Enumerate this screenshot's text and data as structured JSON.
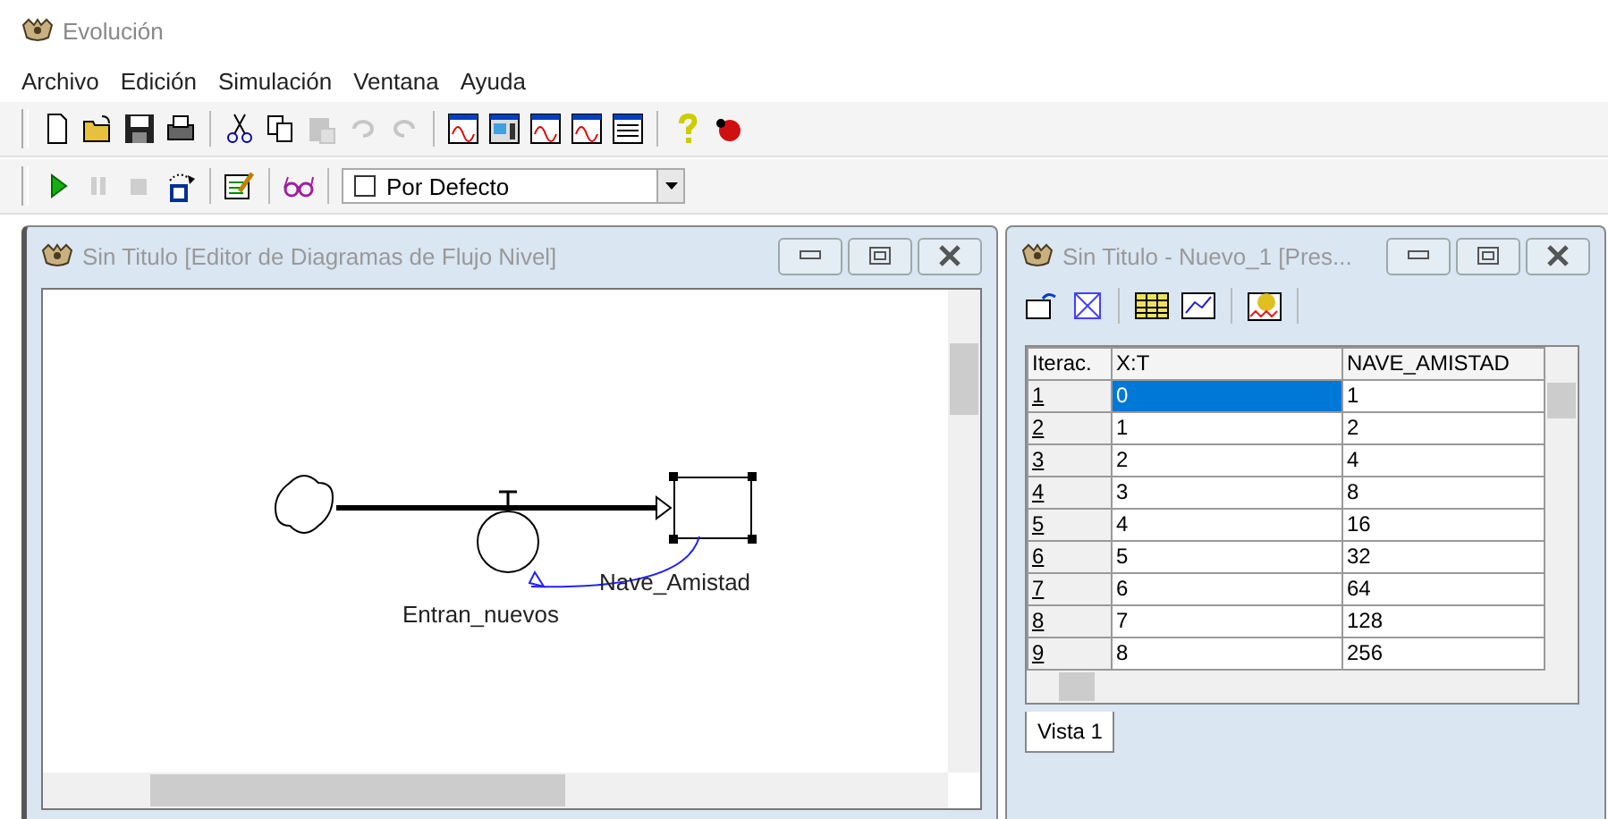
{
  "window": {
    "title": "Evolución"
  },
  "menu": [
    "Archivo",
    "Edición",
    "Simulación",
    "Ventana",
    "Ayuda"
  ],
  "toolbar1": [
    {
      "disabled": false
    },
    {
      "disabled": false
    },
    {
      "disabled": false
    },
    {
      "disabled": false
    },
    {
      "disabled": false
    },
    {
      "disabled": false
    },
    {
      "disabled": true
    },
    {
      "disabled": true
    },
    {
      "disabled": true
    },
    {
      "disabled": false
    },
    {
      "disabled": false
    },
    {
      "disabled": false
    },
    {
      "disabled": false
    },
    {
      "disabled": false
    },
    {
      "disabled": false
    },
    {
      "disabled": false
    }
  ],
  "toolbar2": [
    {
      "disabled": false
    },
    {
      "disabled": true
    },
    {
      "disabled": true
    },
    {
      "disabled": false
    },
    {
      "disabled": false
    },
    {
      "disabled": false
    }
  ],
  "scenario_dropdown": {
    "value": "Por Defecto",
    "checked": false
  },
  "editor_window": {
    "title": "Sin Titulo [Editor de Diagramas de Flujo Nivel]",
    "flow": {
      "name": "Entran_nuevos"
    },
    "stock": {
      "name": "Nave_Amistad",
      "selected": true
    }
  },
  "table_window": {
    "title": "Sin Titulo - Nuevo_1 [Pres...",
    "table": {
      "columns": [
        "Iterac.",
        "X:T",
        "NAVE_AMISTAD"
      ],
      "rows": [
        {
          "cells": [
            "1",
            "0",
            "1"
          ],
          "selected": true
        },
        {
          "cells": [
            "2",
            "1",
            "2"
          ],
          "selected": false
        },
        {
          "cells": [
            "3",
            "2",
            "4"
          ],
          "selected": false
        },
        {
          "cells": [
            "4",
            "3",
            "8"
          ],
          "selected": false
        },
        {
          "cells": [
            "5",
            "4",
            "16"
          ],
          "selected": false
        },
        {
          "cells": [
            "6",
            "5",
            "32"
          ],
          "selected": false
        },
        {
          "cells": [
            "7",
            "6",
            "64"
          ],
          "selected": false
        },
        {
          "cells": [
            "8",
            "7",
            "128"
          ],
          "selected": false
        },
        {
          "cells": [
            "9",
            "8",
            "256"
          ],
          "selected": false
        }
      ]
    },
    "tabs": [
      {
        "label": "Vista 1",
        "selected": true
      }
    ]
  }
}
